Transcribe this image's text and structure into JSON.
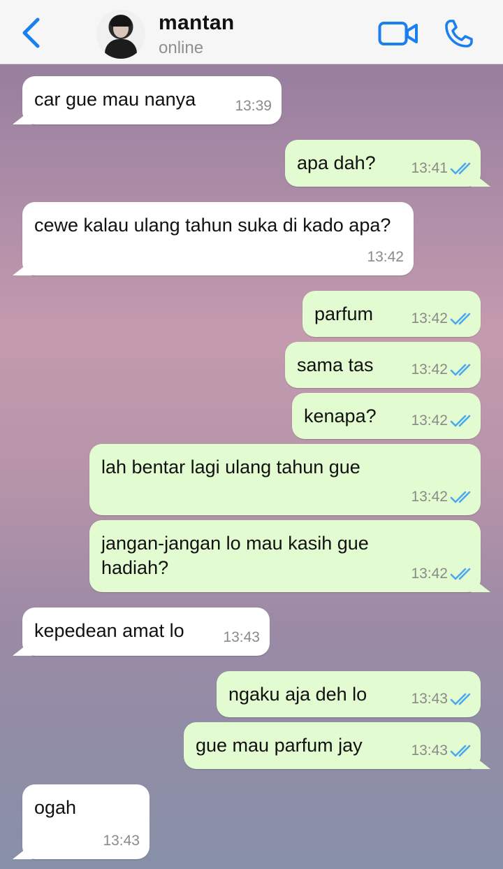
{
  "header": {
    "contact_name": "mantan",
    "status": "online",
    "icons": [
      "back-chevron-icon",
      "avatar",
      "video-call-icon",
      "phone-call-icon"
    ],
    "accent_color": "#1a80f0"
  },
  "colors": {
    "incoming_bubble": "#ffffff",
    "outgoing_bubble": "#e2fbd0",
    "read_ticks": "#4aa8f0"
  },
  "messages": [
    {
      "dir": "in",
      "text": "car gue mau nanya",
      "time": "13:39"
    },
    {
      "dir": "out",
      "text": "apa dah?",
      "time": "13:41",
      "status": "read"
    },
    {
      "dir": "in",
      "text": "cewe kalau ulang tahun suka di kado apa?",
      "time": "13:42"
    },
    {
      "dir": "out",
      "text": "parfum",
      "time": "13:42",
      "status": "read"
    },
    {
      "dir": "out",
      "text": "sama tas",
      "time": "13:42",
      "status": "read"
    },
    {
      "dir": "out",
      "text": "kenapa?",
      "time": "13:42",
      "status": "read"
    },
    {
      "dir": "out",
      "text": "lah bentar lagi ulang tahun gue",
      "time": "13:42",
      "status": "read"
    },
    {
      "dir": "out",
      "text": "jangan-jangan lo mau kasih gue hadiah?",
      "time": "13:42",
      "status": "read"
    },
    {
      "dir": "in",
      "text": "kepedean amat lo",
      "time": "13:43"
    },
    {
      "dir": "out",
      "text": "ngaku aja deh lo",
      "time": "13:43",
      "status": "read"
    },
    {
      "dir": "out",
      "text": "gue mau parfum jay",
      "time": "13:43",
      "status": "read"
    },
    {
      "dir": "in",
      "text": "ogah",
      "time": "13:43"
    }
  ]
}
